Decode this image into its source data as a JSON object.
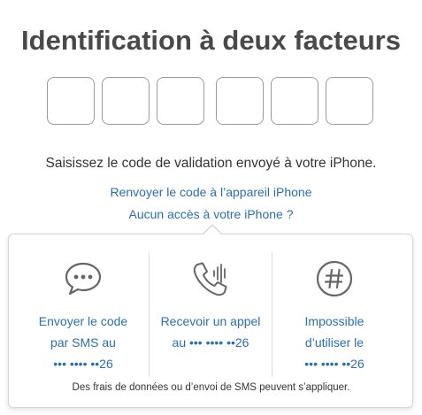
{
  "title": "Identification à deux facteurs",
  "code_inputs": [
    "",
    "",
    "",
    "",
    "",
    ""
  ],
  "instruction": "Saisissez le code de validation envoyé à votre iPhone.",
  "links": {
    "resend": "Renvoyer le code à l’appareil iPhone",
    "no_access": "Aucun accès à votre iPhone ?"
  },
  "options": [
    {
      "icon": "chat-bubble-icon",
      "lines": [
        "Envoyer le code",
        "par SMS au",
        "••• •••• ••26"
      ]
    },
    {
      "icon": "phone-call-icon",
      "lines": [
        "Recevoir un appel",
        "au ••• •••• ••26"
      ]
    },
    {
      "icon": "hash-circle-icon",
      "lines": [
        "Impossible",
        "d’utiliser le",
        "••• •••• ••26"
      ]
    }
  ],
  "footnote": "Des frais de données ou d’envoi de SMS peuvent s’appliquer.",
  "colors": {
    "link": "#2a6fb0",
    "title": "#494949",
    "icon": "#666666",
    "border": "#d6d6d6"
  }
}
